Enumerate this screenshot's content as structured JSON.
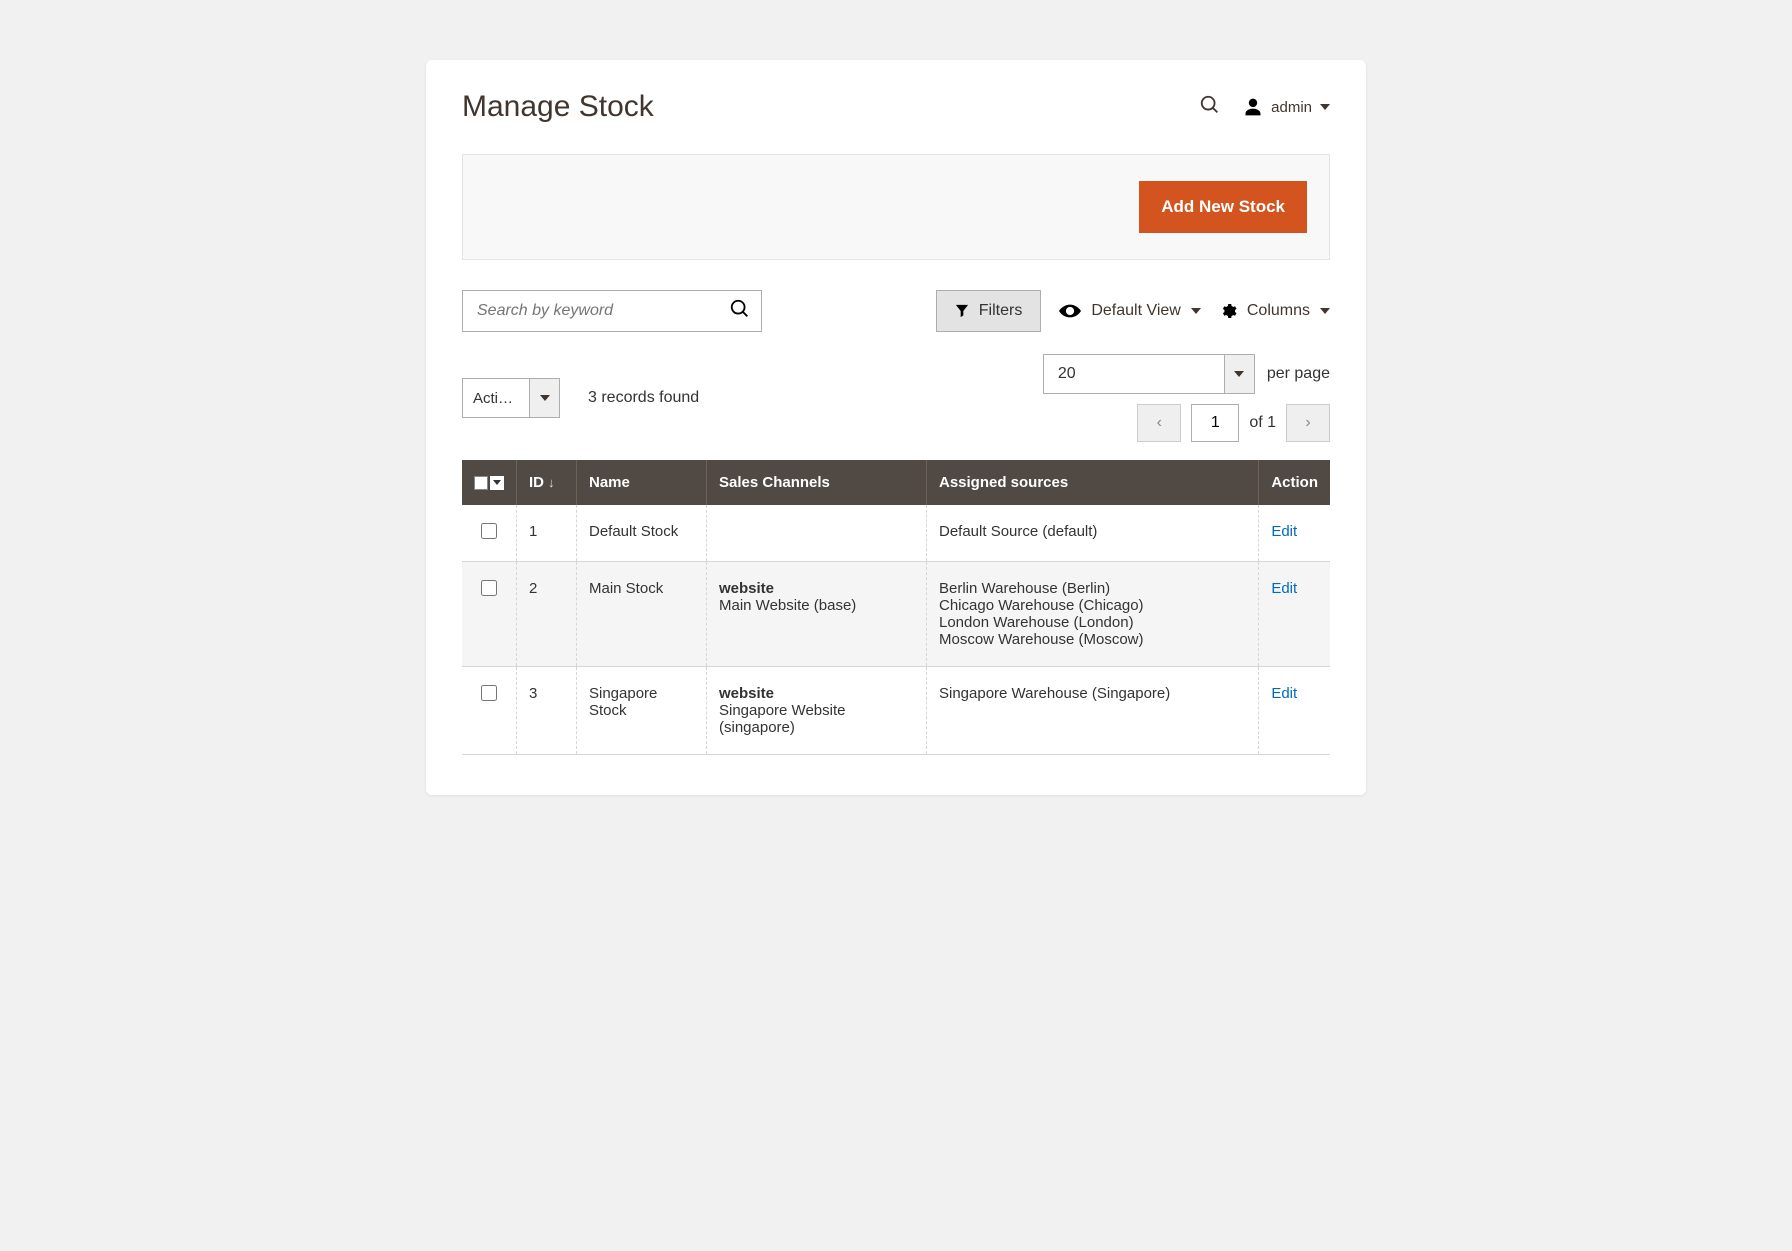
{
  "header": {
    "title": "Manage Stock",
    "username": "admin"
  },
  "actionbar": {
    "add_new_stock": "Add New Stock"
  },
  "toolbar": {
    "search_placeholder": "Search by keyword",
    "filters_label": "Filters",
    "default_view_label": "Default View",
    "columns_label": "Columns",
    "actions_label": "Actions",
    "records_found": "3 records found",
    "per_page_value": "20",
    "per_page_label": "per page",
    "current_page": "1",
    "of_label": "of 1"
  },
  "columns": {
    "id": "ID",
    "name": "Name",
    "sales_channels": "Sales Channels",
    "assigned_sources": "Assigned sources",
    "action": "Action"
  },
  "rows": [
    {
      "id": "1",
      "name": "Default Stock",
      "sc_type": "",
      "sc_value": "",
      "sources": "Default Source (default)",
      "action": "Edit"
    },
    {
      "id": "2",
      "name": "Main Stock",
      "sc_type": "website",
      "sc_value": "Main Website (base)",
      "sources": "Berlin Warehouse (Berlin)\nChicago Warehouse (Chicago)\nLondon Warehouse (London)\nMoscow Warehouse (Moscow)",
      "action": "Edit"
    },
    {
      "id": "3",
      "name": "Singapore Stock",
      "sc_type": "website",
      "sc_value": "Singapore Website (singapore)",
      "sources": "Singapore Warehouse (Singapore)",
      "action": "Edit"
    }
  ]
}
